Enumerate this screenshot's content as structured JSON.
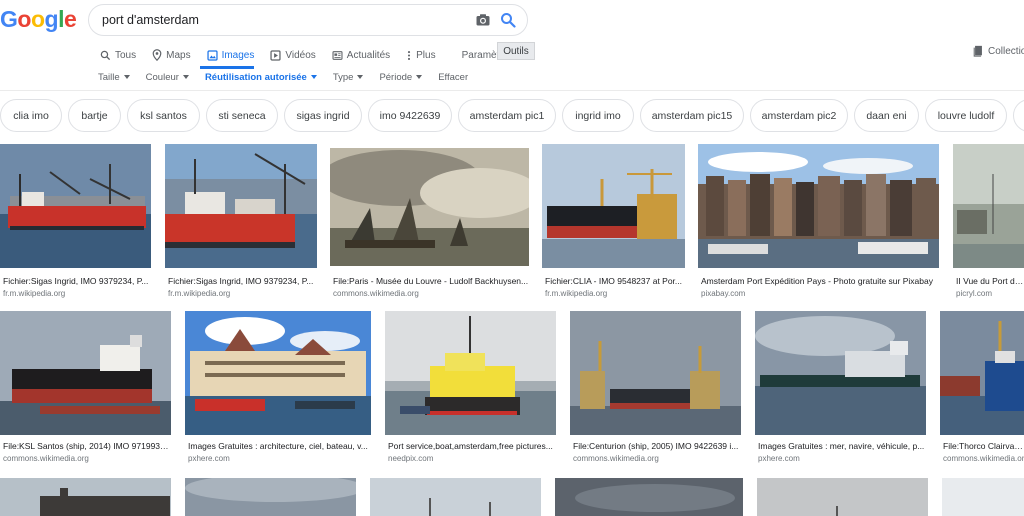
{
  "logo": {
    "letters": [
      "G",
      "o",
      "o",
      "g",
      "l",
      "e"
    ],
    "colors": [
      "#4285F4",
      "#EA4335",
      "#FBBC05",
      "#4285F4",
      "#34A853",
      "#EA4335"
    ]
  },
  "search": {
    "query": "port d'amsterdam"
  },
  "tabs": [
    {
      "label": "Tous",
      "icon": "search-icon"
    },
    {
      "label": "Maps",
      "icon": "map-pin-icon"
    },
    {
      "label": "Images",
      "icon": "image-icon",
      "active": true
    },
    {
      "label": "Vidéos",
      "icon": "video-icon"
    },
    {
      "label": "Actualités",
      "icon": "news-icon"
    },
    {
      "label": "Plus",
      "icon": "more-vert-icon"
    },
    {
      "label": "Paramètres",
      "icon": ""
    }
  ],
  "tools_label": "Outils",
  "collections_label": "Collections",
  "filters": [
    {
      "label": "Taille",
      "caret": true
    },
    {
      "label": "Couleur",
      "caret": true
    },
    {
      "label": "Réutilisation autorisée",
      "caret": true,
      "active": true
    },
    {
      "label": "Type",
      "caret": true
    },
    {
      "label": "Période",
      "caret": true
    },
    {
      "label": "Effacer",
      "caret": false
    }
  ],
  "chips": [
    "clia imo",
    "bartje",
    "ksl santos",
    "sti seneca",
    "sigas ingrid",
    "imo 9422639",
    "amsterdam pic1",
    "ingrid imo",
    "amsterdam pic15",
    "amsterdam pic2",
    "daan eni",
    "louvre ludolf"
  ],
  "results": [
    {
      "title": "Fichier:Sigas Ingrid, IMO 9379234, P...",
      "source": "fr.m.wikipedia.org"
    },
    {
      "title": "Fichier:Sigas Ingrid, IMO 9379234, P...",
      "source": "fr.m.wikipedia.org"
    },
    {
      "title": "File:Paris - Musée du Louvre - Ludolf Backhuysen...",
      "source": "commons.wikimedia.org"
    },
    {
      "title": "Fichier:CLIA - IMO 9548237 at Por...",
      "source": "fr.m.wikipedia.org"
    },
    {
      "title": "Amsterdam Port Expédition Pays - Photo gratuite sur Pixabay",
      "source": "pixabay.com"
    },
    {
      "title": "II Vue du Port d'Amsterdam",
      "source": "picryl.com"
    },
    {
      "title": "File:KSL Santos (ship, 2014) IMO 9719939...",
      "source": "commons.wikimedia.org"
    },
    {
      "title": "Images Gratuites : architecture, ciel, bateau, v...",
      "source": "pxhere.com"
    },
    {
      "title": "Port service,boat,amsterdam,free pictures...",
      "source": "needpix.com"
    },
    {
      "title": "File:Centurion (ship, 2005) IMO 9422639 i...",
      "source": "commons.wikimedia.org"
    },
    {
      "title": "Images Gratuites : mer, navire, véhicule, p...",
      "source": "pxhere.com"
    },
    {
      "title": "File:Thorco Clairvaux, IMO",
      "source": "commons.wikimedia.org"
    }
  ]
}
